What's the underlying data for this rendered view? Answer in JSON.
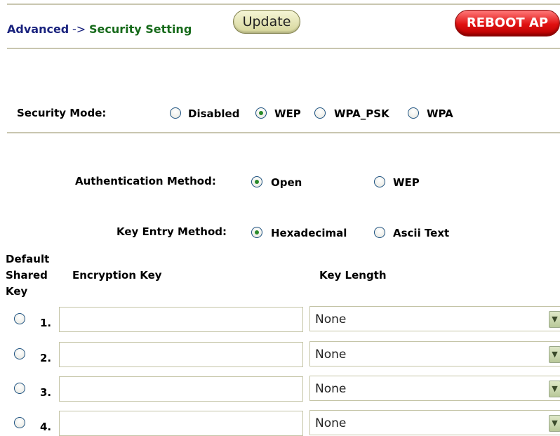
{
  "breadcrumb": {
    "root": "Advanced",
    "separator": "->",
    "current": "Security Setting"
  },
  "buttons": {
    "update": "Update",
    "reboot": "REBOOT AP"
  },
  "security_mode": {
    "label": "Security Mode:",
    "options": [
      "Disabled",
      "WEP",
      "WPA_PSK",
      "WPA"
    ],
    "selected": "WEP"
  },
  "auth_method": {
    "label": "Authentication Method:",
    "options": [
      "Open",
      "WEP"
    ],
    "selected": "Open"
  },
  "key_entry": {
    "label": "Key Entry Method:",
    "options": [
      "Hexadecimal",
      "Ascii Text"
    ],
    "selected": "Hexadecimal"
  },
  "keys_table": {
    "col_default": [
      "Default",
      "Shared",
      "Key"
    ],
    "col_encryption": "Encryption Key",
    "col_length": "Key Length",
    "rows": [
      {
        "num": "1.",
        "key": "",
        "length": "None"
      },
      {
        "num": "2.",
        "key": "",
        "length": "None"
      },
      {
        "num": "3.",
        "key": "",
        "length": "None"
      },
      {
        "num": "4.",
        "key": "",
        "length": "None"
      }
    ]
  },
  "colors": {
    "rule": "#c9c6b0",
    "breadcrumb_root": "#1a237e",
    "breadcrumb_current": "#166a1a",
    "reboot": "#e01010"
  }
}
